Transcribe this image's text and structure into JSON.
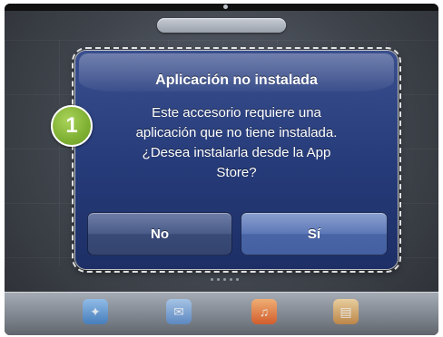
{
  "alert": {
    "title": "Aplicación no instalada",
    "message_lines": [
      "Este accesorio requiere una",
      "aplicación que no tiene instalada.",
      "¿Desea instalarla desde la App",
      "Store?"
    ],
    "buttons": {
      "no_label": "No",
      "yes_label": "Sí"
    }
  },
  "annotation": {
    "step_number": "1"
  },
  "colors": {
    "alert_blue": "#253a78",
    "badge_green": "#7fb032"
  },
  "icons": {
    "dock": [
      "safari-icon",
      "mail-icon",
      "music-icon",
      "ibooks-icon"
    ]
  }
}
